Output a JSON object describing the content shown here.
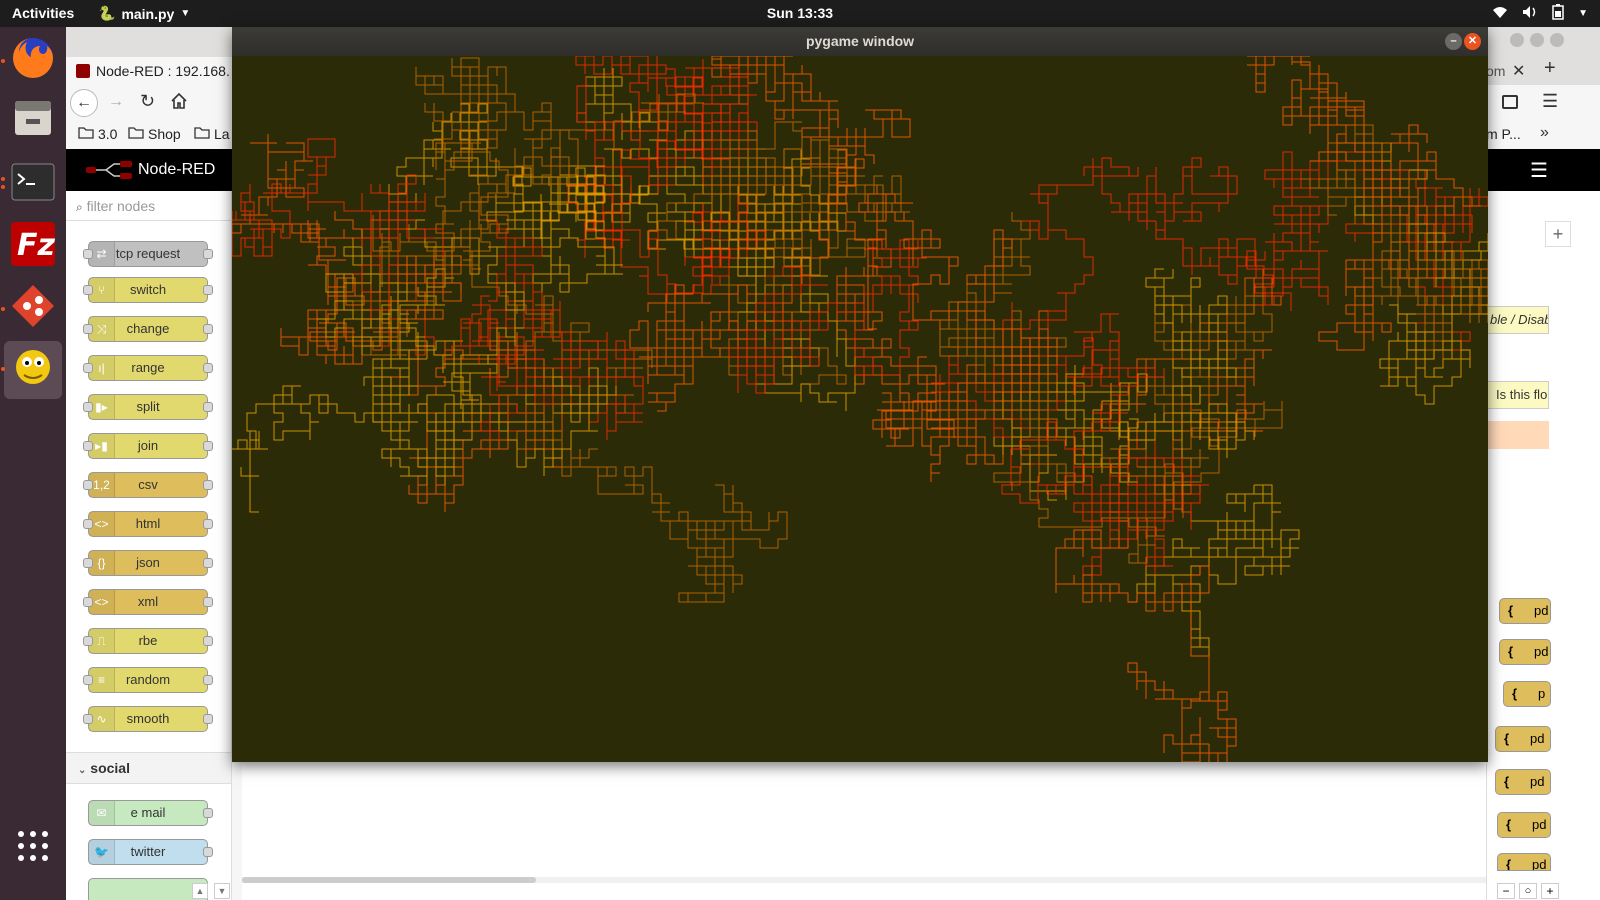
{
  "topbar": {
    "activities": "Activities",
    "app_name": "main.py",
    "clock": "Sun 13:33"
  },
  "dock": {
    "items": [
      "firefox-icon",
      "files-icon",
      "terminal-icon",
      "filezilla-icon",
      "git-icon",
      "python-icon",
      "app-grid-icon"
    ]
  },
  "browser": {
    "tab_title": "Node-RED : 192.168.",
    "right_tab_fragment": "om",
    "bookmarks": [
      "3.0",
      "Shop",
      "La"
    ],
    "bookmark_right": "m P..."
  },
  "nodered": {
    "header_title": "Node-RED",
    "filter_placeholder": "filter nodes",
    "palette_nodes": [
      {
        "label": "tcp request",
        "color": "#c0c0c0"
      },
      {
        "label": "switch",
        "color": "#e2d96e"
      },
      {
        "label": "change",
        "color": "#e2d96e"
      },
      {
        "label": "range",
        "color": "#e2d96e"
      },
      {
        "label": "split",
        "color": "#e2d96e"
      },
      {
        "label": "join",
        "color": "#e2d96e"
      },
      {
        "label": "csv",
        "color": "#debd5c"
      },
      {
        "label": "html",
        "color": "#debd5c"
      },
      {
        "label": "json",
        "color": "#debd5c"
      },
      {
        "label": "xml",
        "color": "#debd5c"
      },
      {
        "label": "rbe",
        "color": "#e2d96e"
      },
      {
        "label": "random",
        "color": "#e2d96e"
      },
      {
        "label": "smooth",
        "color": "#e2d96e"
      }
    ],
    "category_social": "social",
    "social_nodes": [
      {
        "label": "e mail",
        "color": "#c7e9c0"
      },
      {
        "label": "twitter",
        "color": "#c0deed"
      }
    ],
    "right_notes": [
      "ble / Disab",
      "Is this flo"
    ],
    "right_nodes": [
      "pd",
      "pd",
      "p",
      "pd",
      "pd",
      "pd",
      "pd"
    ]
  },
  "pygame": {
    "title": "pygame window",
    "bg_color": "#2b2c07",
    "line_colors": [
      "#ff5a00",
      "#e8a000",
      "#ff2a00",
      "#c86a00"
    ]
  }
}
